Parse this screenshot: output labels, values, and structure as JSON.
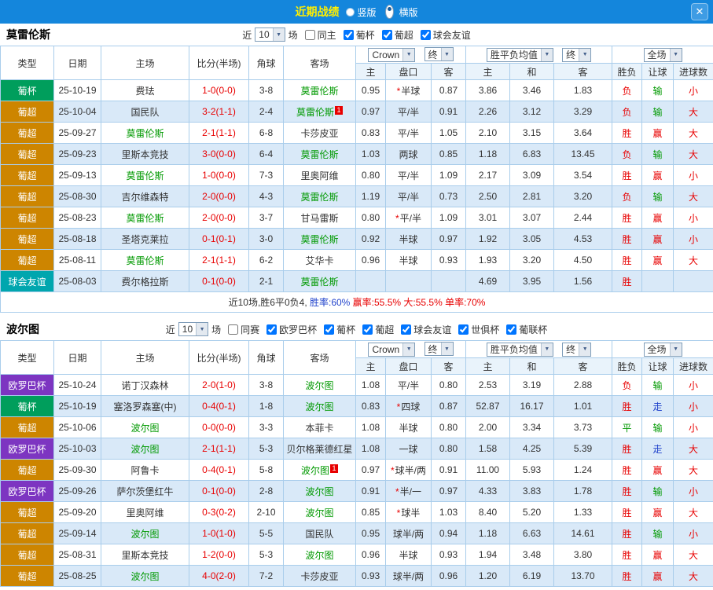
{
  "topbar": {
    "title": "近期战绩",
    "vertical_label": "竖版",
    "horizontal_label": "横版",
    "selected_option": "横版"
  },
  "icons": {
    "chevron_down": "▼",
    "close": "✕"
  },
  "controls": {
    "near": "近",
    "count": "10",
    "matches": "场"
  },
  "header": {
    "type": "类型",
    "date": "日期",
    "home": "主场",
    "score": "比分(半场)",
    "corner": "角球",
    "away": "客场",
    "company": "Crown",
    "final": "终",
    "odds_home": "主",
    "handicap": "盘口",
    "odds_away": "客",
    "wdl": "胜平负均值",
    "wdl_home": "主",
    "wdl_draw": "和",
    "wdl_away": "客",
    "scope": "全场",
    "result": "胜负",
    "handicap_result": "让球",
    "goals": "进球数"
  },
  "colors": {
    "accent_bar": "#1486dc",
    "subject_team": "#009900",
    "score": "#e80000",
    "types": {
      "葡杯": "#009e5c",
      "葡超": "#cd8500",
      "球会友谊": "#00a6ae",
      "欧罗巴杯": "#7d35c1"
    }
  },
  "sections": [
    {
      "team": "莫雷伦斯",
      "filters": [
        {
          "label": "同主",
          "checked": false
        },
        {
          "label": "葡杯",
          "checked": true
        },
        {
          "label": "葡超",
          "checked": true
        },
        {
          "label": "球会友谊",
          "checked": true
        }
      ],
      "rows": [
        {
          "type": "葡杯",
          "date": "25-10-19",
          "home": "费珐",
          "home_subject": false,
          "home_badge": "",
          "score": "1-0(0-0)",
          "corner": "3-8",
          "away": "莫雷伦斯",
          "away_subject": true,
          "away_badge": "",
          "oh": "0.95",
          "hcap": "半球",
          "hstar": true,
          "oa": "0.87",
          "wh": "3.86",
          "wd": "3.46",
          "wa": "1.83",
          "res": "负",
          "res_c": "red",
          "hres": "输",
          "hres_c": "green",
          "gres": "小",
          "gres_c": "red"
        },
        {
          "type": "葡超",
          "date": "25-10-04",
          "home": "国民队",
          "home_subject": false,
          "home_badge": "",
          "score": "3-2(1-1)",
          "corner": "2-4",
          "away": "莫雷伦斯",
          "away_subject": true,
          "away_badge": "1",
          "oh": "0.97",
          "hcap": "平/半",
          "hstar": false,
          "oa": "0.91",
          "wh": "2.26",
          "wd": "3.12",
          "wa": "3.29",
          "res": "负",
          "res_c": "red",
          "hres": "输",
          "hres_c": "green",
          "gres": "大",
          "gres_c": "red"
        },
        {
          "type": "葡超",
          "date": "25-09-27",
          "home": "莫雷伦斯",
          "home_subject": true,
          "home_badge": "",
          "score": "2-1(1-1)",
          "corner": "6-8",
          "away": "卡莎皮亚",
          "away_subject": false,
          "away_badge": "",
          "oh": "0.83",
          "hcap": "平/半",
          "hstar": false,
          "oa": "1.05",
          "wh": "2.10",
          "wd": "3.15",
          "wa": "3.64",
          "res": "胜",
          "res_c": "red",
          "hres": "赢",
          "hres_c": "red",
          "gres": "大",
          "gres_c": "red"
        },
        {
          "type": "葡超",
          "date": "25-09-23",
          "home": "里斯本竞技",
          "home_subject": false,
          "home_badge": "",
          "score": "3-0(0-0)",
          "corner": "6-4",
          "away": "莫雷伦斯",
          "away_subject": true,
          "away_badge": "",
          "oh": "1.03",
          "hcap": "两球",
          "hstar": false,
          "oa": "0.85",
          "wh": "1.18",
          "wd": "6.83",
          "wa": "13.45",
          "res": "负",
          "res_c": "red",
          "hres": "输",
          "hres_c": "green",
          "gres": "大",
          "gres_c": "red"
        },
        {
          "type": "葡超",
          "date": "25-09-13",
          "home": "莫雷伦斯",
          "home_subject": true,
          "home_badge": "",
          "score": "1-0(0-0)",
          "corner": "7-3",
          "away": "里奥阿维",
          "away_subject": false,
          "away_badge": "",
          "oh": "0.80",
          "hcap": "平/半",
          "hstar": false,
          "oa": "1.09",
          "wh": "2.17",
          "wd": "3.09",
          "wa": "3.54",
          "res": "胜",
          "res_c": "red",
          "hres": "赢",
          "hres_c": "red",
          "gres": "小",
          "gres_c": "red"
        },
        {
          "type": "葡超",
          "date": "25-08-30",
          "home": "吉尔维森特",
          "home_subject": false,
          "home_badge": "",
          "score": "2-0(0-0)",
          "corner": "4-3",
          "away": "莫雷伦斯",
          "away_subject": true,
          "away_badge": "",
          "oh": "1.19",
          "hcap": "平/半",
          "hstar": false,
          "oa": "0.73",
          "wh": "2.50",
          "wd": "2.81",
          "wa": "3.20",
          "res": "负",
          "res_c": "red",
          "hres": "输",
          "hres_c": "green",
          "gres": "大",
          "gres_c": "red"
        },
        {
          "type": "葡超",
          "date": "25-08-23",
          "home": "莫雷伦斯",
          "home_subject": true,
          "home_badge": "",
          "score": "2-0(0-0)",
          "corner": "3-7",
          "away": "甘马雷斯",
          "away_subject": false,
          "away_badge": "",
          "oh": "0.80",
          "hcap": "平/半",
          "hstar": true,
          "oa": "1.09",
          "wh": "3.01",
          "wd": "3.07",
          "wa": "2.44",
          "res": "胜",
          "res_c": "red",
          "hres": "赢",
          "hres_c": "red",
          "gres": "小",
          "gres_c": "red"
        },
        {
          "type": "葡超",
          "date": "25-08-18",
          "home": "圣塔克莱拉",
          "home_subject": false,
          "home_badge": "",
          "score": "0-1(0-1)",
          "corner": "3-0",
          "away": "莫雷伦斯",
          "away_subject": true,
          "away_badge": "",
          "oh": "0.92",
          "hcap": "半球",
          "hstar": false,
          "oa": "0.97",
          "wh": "1.92",
          "wd": "3.05",
          "wa": "4.53",
          "res": "胜",
          "res_c": "red",
          "hres": "赢",
          "hres_c": "red",
          "gres": "小",
          "gres_c": "red"
        },
        {
          "type": "葡超",
          "date": "25-08-11",
          "home": "莫雷伦斯",
          "home_subject": true,
          "home_badge": "",
          "score": "2-1(1-1)",
          "corner": "6-2",
          "away": "艾华卡",
          "away_subject": false,
          "away_badge": "",
          "oh": "0.96",
          "hcap": "半球",
          "hstar": false,
          "oa": "0.93",
          "wh": "1.93",
          "wd": "3.20",
          "wa": "4.50",
          "res": "胜",
          "res_c": "red",
          "hres": "赢",
          "hres_c": "red",
          "gres": "大",
          "gres_c": "red"
        },
        {
          "type": "球会友谊",
          "date": "25-08-03",
          "home": "费尔格拉斯",
          "home_subject": false,
          "home_badge": "",
          "score": "0-1(0-0)",
          "corner": "2-1",
          "away": "莫雷伦斯",
          "away_subject": true,
          "away_badge": "",
          "oh": "",
          "hcap": "",
          "hstar": false,
          "oa": "",
          "wh": "4.69",
          "wd": "3.95",
          "wa": "1.56",
          "res": "胜",
          "res_c": "red",
          "hres": "",
          "hres_c": "black",
          "gres": "",
          "gres_c": "black"
        }
      ],
      "summary": [
        {
          "text": "近10场,胜6平0负4, ",
          "c": "black"
        },
        {
          "text": "胜率:60% ",
          "c": "blue"
        },
        {
          "text": "赢率:55.5% ",
          "c": "red"
        },
        {
          "text": "大:55.5% ",
          "c": "red"
        },
        {
          "text": "单率:70%",
          "c": "red"
        }
      ]
    },
    {
      "team": "波尔图",
      "filters": [
        {
          "label": "同赛",
          "checked": false
        },
        {
          "label": "欧罗巴杯",
          "checked": true
        },
        {
          "label": "葡杯",
          "checked": true
        },
        {
          "label": "葡超",
          "checked": true
        },
        {
          "label": "球会友谊",
          "checked": true
        },
        {
          "label": "世俱杯",
          "checked": true
        },
        {
          "label": "葡联杯",
          "checked": true
        }
      ],
      "rows": [
        {
          "type": "欧罗巴杯",
          "date": "25-10-24",
          "home": "诺丁汉森林",
          "home_subject": false,
          "home_badge": "",
          "score": "2-0(1-0)",
          "corner": "3-8",
          "away": "波尔图",
          "away_subject": true,
          "away_badge": "",
          "oh": "1.08",
          "hcap": "平/半",
          "hstar": false,
          "oa": "0.80",
          "wh": "2.53",
          "wd": "3.19",
          "wa": "2.88",
          "res": "负",
          "res_c": "red",
          "hres": "输",
          "hres_c": "green",
          "gres": "小",
          "gres_c": "red"
        },
        {
          "type": "葡杯",
          "date": "25-10-19",
          "home": "塞洛罗森塞(中)",
          "home_subject": false,
          "home_badge": "",
          "score": "0-4(0-1)",
          "corner": "1-8",
          "away": "波尔图",
          "away_subject": true,
          "away_badge": "",
          "oh": "0.83",
          "hcap": "四球",
          "hstar": true,
          "oa": "0.87",
          "wh": "52.87",
          "wd": "16.17",
          "wa": "1.01",
          "res": "胜",
          "res_c": "red",
          "hres": "走",
          "hres_c": "blue",
          "gres": "小",
          "gres_c": "red"
        },
        {
          "type": "葡超",
          "date": "25-10-06",
          "home": "波尔图",
          "home_subject": true,
          "home_badge": "",
          "score": "0-0(0-0)",
          "corner": "3-3",
          "away": "本菲卡",
          "away_subject": false,
          "away_badge": "",
          "oh": "1.08",
          "hcap": "半球",
          "hstar": false,
          "oa": "0.80",
          "wh": "2.00",
          "wd": "3.34",
          "wa": "3.73",
          "res": "平",
          "res_c": "green",
          "hres": "输",
          "hres_c": "green",
          "gres": "小",
          "gres_c": "red"
        },
        {
          "type": "欧罗巴杯",
          "date": "25-10-03",
          "home": "波尔图",
          "home_subject": true,
          "home_badge": "",
          "score": "2-1(1-1)",
          "corner": "5-3",
          "away": "贝尔格莱德红星",
          "away_subject": false,
          "away_badge": "",
          "oh": "1.08",
          "hcap": "一球",
          "hstar": false,
          "oa": "0.80",
          "wh": "1.58",
          "wd": "4.25",
          "wa": "5.39",
          "res": "胜",
          "res_c": "red",
          "hres": "走",
          "hres_c": "blue",
          "gres": "大",
          "gres_c": "red"
        },
        {
          "type": "葡超",
          "date": "25-09-30",
          "home": "阿鲁卡",
          "home_subject": false,
          "home_badge": "",
          "score": "0-4(0-1)",
          "corner": "5-8",
          "away": "波尔图",
          "away_subject": true,
          "away_badge": "1",
          "oh": "0.97",
          "hcap": "球半/两",
          "hstar": true,
          "oa": "0.91",
          "wh": "11.00",
          "wd": "5.93",
          "wa": "1.24",
          "res": "胜",
          "res_c": "red",
          "hres": "赢",
          "hres_c": "red",
          "gres": "大",
          "gres_c": "red"
        },
        {
          "type": "欧罗巴杯",
          "date": "25-09-26",
          "home": "萨尔茨堡红牛",
          "home_subject": false,
          "home_badge": "",
          "score": "0-1(0-0)",
          "corner": "2-8",
          "away": "波尔图",
          "away_subject": true,
          "away_badge": "",
          "oh": "0.91",
          "hcap": "半/一",
          "hstar": true,
          "oa": "0.97",
          "wh": "4.33",
          "wd": "3.83",
          "wa": "1.78",
          "res": "胜",
          "res_c": "red",
          "hres": "输",
          "hres_c": "green",
          "gres": "小",
          "gres_c": "red"
        },
        {
          "type": "葡超",
          "date": "25-09-20",
          "home": "里奥阿维",
          "home_subject": false,
          "home_badge": "",
          "score": "0-3(0-2)",
          "corner": "2-10",
          "away": "波尔图",
          "away_subject": true,
          "away_badge": "",
          "oh": "0.85",
          "hcap": "球半",
          "hstar": true,
          "oa": "1.03",
          "wh": "8.40",
          "wd": "5.20",
          "wa": "1.33",
          "res": "胜",
          "res_c": "red",
          "hres": "赢",
          "hres_c": "red",
          "gres": "大",
          "gres_c": "red"
        },
        {
          "type": "葡超",
          "date": "25-09-14",
          "home": "波尔图",
          "home_subject": true,
          "home_badge": "",
          "score": "1-0(1-0)",
          "corner": "5-5",
          "away": "国民队",
          "away_subject": false,
          "away_badge": "",
          "oh": "0.95",
          "hcap": "球半/两",
          "hstar": false,
          "oa": "0.94",
          "wh": "1.18",
          "wd": "6.63",
          "wa": "14.61",
          "res": "胜",
          "res_c": "red",
          "hres": "输",
          "hres_c": "green",
          "gres": "小",
          "gres_c": "red"
        },
        {
          "type": "葡超",
          "date": "25-08-31",
          "home": "里斯本竞技",
          "home_subject": false,
          "home_badge": "",
          "score": "1-2(0-0)",
          "corner": "5-3",
          "away": "波尔图",
          "away_subject": true,
          "away_badge": "",
          "oh": "0.96",
          "hcap": "半球",
          "hstar": false,
          "oa": "0.93",
          "wh": "1.94",
          "wd": "3.48",
          "wa": "3.80",
          "res": "胜",
          "res_c": "red",
          "hres": "赢",
          "hres_c": "red",
          "gres": "大",
          "gres_c": "red"
        },
        {
          "type": "葡超",
          "date": "25-08-25",
          "home": "波尔图",
          "home_subject": true,
          "home_badge": "",
          "score": "4-0(2-0)",
          "corner": "7-2",
          "away": "卡莎皮亚",
          "away_subject": false,
          "away_badge": "",
          "oh": "0.93",
          "hcap": "球半/两",
          "hstar": false,
          "oa": "0.96",
          "wh": "1.20",
          "wd": "6.19",
          "wa": "13.70",
          "res": "胜",
          "res_c": "red",
          "hres": "赢",
          "hres_c": "red",
          "gres": "大",
          "gres_c": "red"
        }
      ],
      "summary": null
    }
  ]
}
